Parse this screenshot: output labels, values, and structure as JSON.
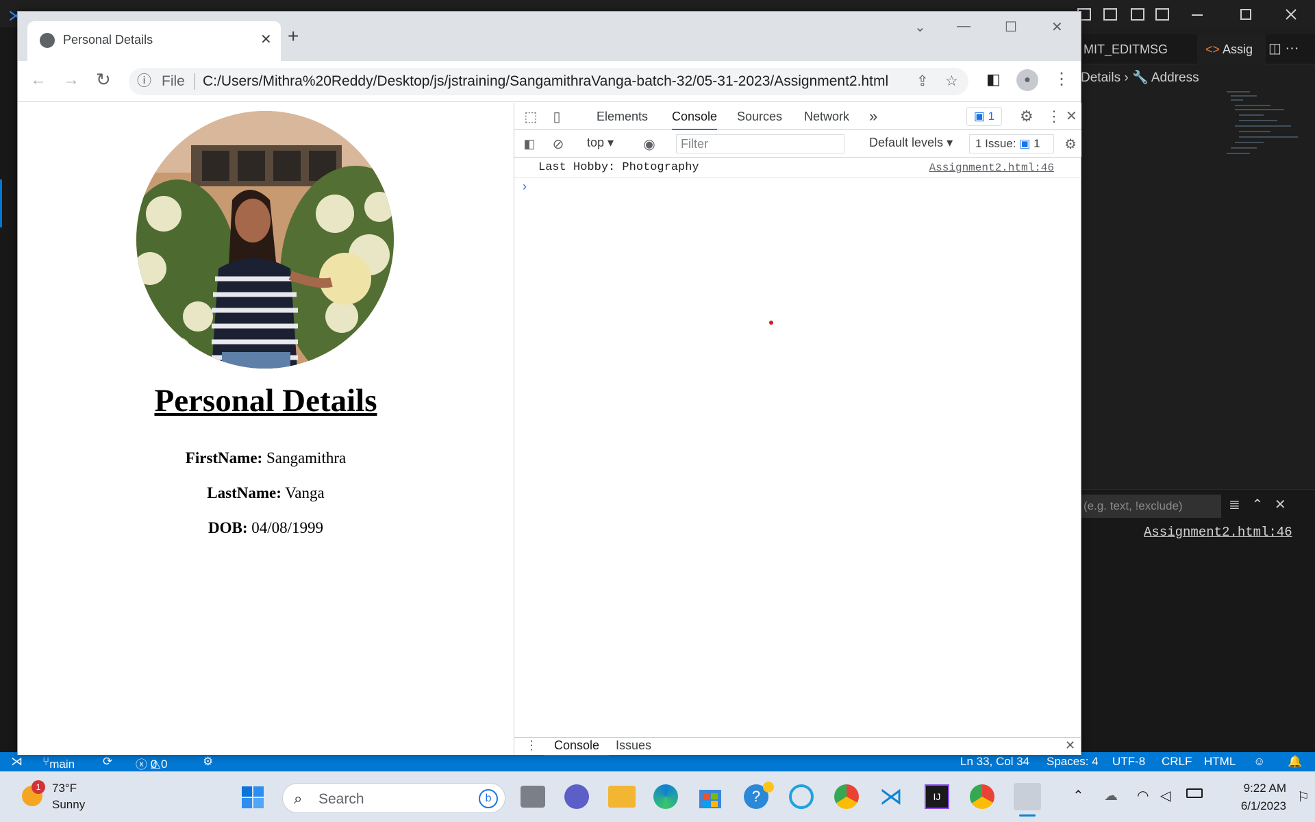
{
  "vscode": {
    "tab_commit": "MIT_EDITMSG",
    "tab_assignment": "Assig",
    "breadcrumb_details": "Details",
    "breadcrumb_address": "Address",
    "panel_filter_placeholder": "(e.g. text, !exclude)",
    "panel_link": "Assignment2.html:46",
    "status": {
      "branch": "main",
      "errors": "0",
      "warnings": "0",
      "position": "Ln 33, Col 34",
      "spaces": "Spaces: 4",
      "encoding": "UTF-8",
      "eol": "CRLF",
      "language": "HTML"
    }
  },
  "browser": {
    "tab_title": "Personal Details",
    "url_scheme": "File",
    "url": "C:/Users/Mithra%20Reddy/Desktop/js/jstraining/SangamithraVanga-batch-32/05-31-2023/Assignment2.html"
  },
  "page": {
    "heading": "Personal Details",
    "fields": [
      {
        "label": "FirstName:",
        "value": "Sangamithra"
      },
      {
        "label": "LastName:",
        "value": "Vanga"
      },
      {
        "label": "DOB:",
        "value": "04/08/1999"
      }
    ]
  },
  "devtools": {
    "tabs": [
      "Elements",
      "Console",
      "Sources",
      "Network"
    ],
    "active_tab": "Console",
    "issues_badge": "1",
    "context": "top",
    "filter_placeholder": "Filter",
    "levels": "Default levels",
    "issues_label": "1 Issue:",
    "issues_count": "1",
    "message": "Last Hobby: Photography",
    "message_source": "Assignment2.html:46",
    "drawer_tabs": [
      "Console",
      "Issues"
    ]
  },
  "taskbar": {
    "weather_temp": "73°F",
    "weather_desc": "Sunny",
    "weather_badge": "1",
    "search_placeholder": "Search",
    "time": "9:22 AM",
    "date": "6/1/2023"
  },
  "colors": {
    "accent": "#1a73e8",
    "status_bar": "#0078d4",
    "taskbar": "#dfe5ee"
  }
}
